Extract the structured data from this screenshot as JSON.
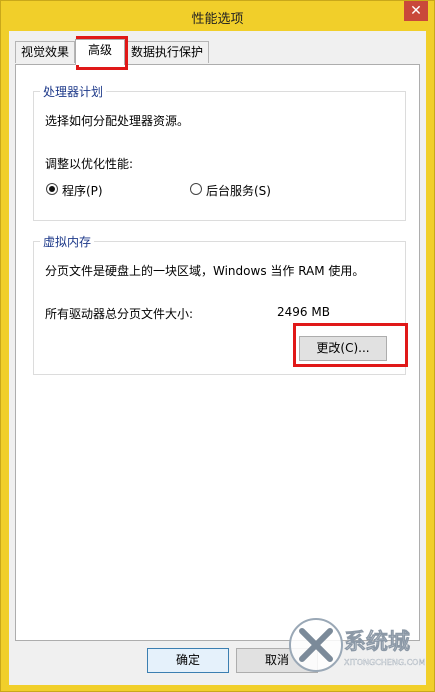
{
  "window": {
    "title": "性能选项",
    "close_glyph": "✕"
  },
  "tabs": [
    {
      "label": "视觉效果"
    },
    {
      "label": "高级"
    },
    {
      "label": "数据执行保护"
    }
  ],
  "processor": {
    "legend": "处理器计划",
    "description": "选择如何分配处理器资源。",
    "adjust_label": "调整以优化性能:",
    "option_programs": "程序(P)",
    "option_background": "后台服务(S)"
  },
  "virtual_memory": {
    "legend": "虚拟内存",
    "description": "分页文件是硬盘上的一块区域，Windows 当作 RAM 使用。",
    "total_label": "所有驱动器总分页文件大小:",
    "total_value": "2496 MB",
    "change_button": "更改(C)..."
  },
  "footer": {
    "ok_button": "确定",
    "cancel_button": "取消"
  },
  "watermark": {
    "text": "系统城",
    "subtext": "XITONGCHENG.COM"
  },
  "colors": {
    "highlight": "#e01818",
    "accent": "#3c7fb1",
    "frame": "#f1cf2a"
  }
}
